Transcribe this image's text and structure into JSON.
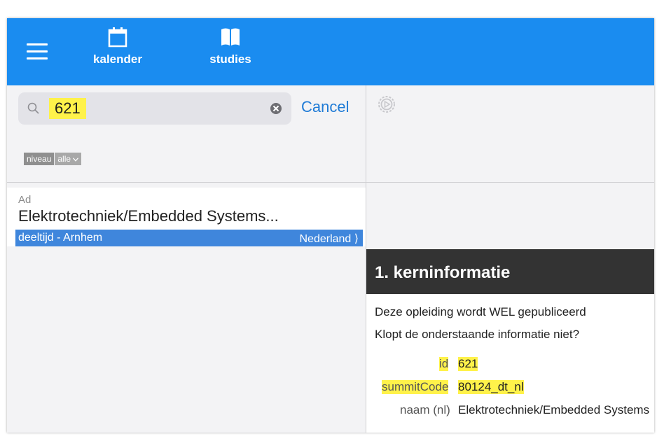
{
  "nav": {
    "items": [
      {
        "label": "kalender",
        "icon": "calendar-icon"
      },
      {
        "label": "studies",
        "icon": "book-icon"
      }
    ]
  },
  "search": {
    "value": "621",
    "cancel_label": "Cancel"
  },
  "filter": {
    "label": "niveau",
    "value": "alle"
  },
  "result": {
    "level": "Ad",
    "title": "Elektrotechniek/Embedded Systems...",
    "detail": "deeltijd - Arnhem",
    "country": "Nederland ⟩"
  },
  "card": {
    "heading": "1. kerninformatie",
    "line1": "Deze opleiding wordt WEL gepubliceerd",
    "line2": "Klopt de onderstaande informatie niet?",
    "fields": [
      {
        "key": "id",
        "value": "621"
      },
      {
        "key": "summitCode",
        "value": "80124_dt_nl"
      },
      {
        "key": "naam (nl)",
        "value": "Elektrotechniek/Embedded Systems"
      }
    ]
  },
  "colors": {
    "topbar": "#1a8cf0",
    "selection": "#3f86dc",
    "highlight": "#fff24a",
    "link": "#1f7bd6"
  }
}
